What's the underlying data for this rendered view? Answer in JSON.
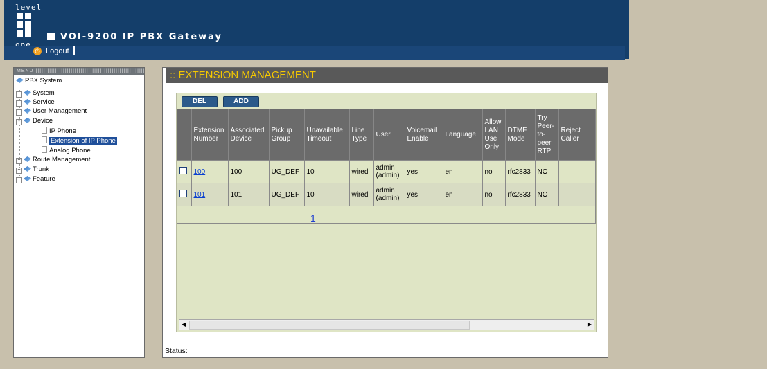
{
  "brand": {
    "logo_top": "level",
    "logo_bottom": "one"
  },
  "header": {
    "product_title": "VOI-9200 IP PBX Gateway",
    "logout_label": "Logout"
  },
  "menu": {
    "heading": "MENU",
    "root": "PBX System",
    "items": [
      {
        "label": "System",
        "expand": "+"
      },
      {
        "label": "Service",
        "expand": "+"
      },
      {
        "label": "User Management",
        "expand": "+"
      },
      {
        "label": "Device",
        "expand": "-"
      },
      {
        "label": "IP Phone"
      },
      {
        "label": "Extension of IP Phone",
        "selected": true
      },
      {
        "label": "Analog Phone"
      },
      {
        "label": "Route Management",
        "expand": "+"
      },
      {
        "label": "Trunk",
        "expand": "+"
      },
      {
        "label": "Feature",
        "expand": "+"
      }
    ]
  },
  "page": {
    "title": ":: EXTENSION MANAGEMENT",
    "del_label": "DEL",
    "add_label": "ADD",
    "columns": [
      "Extension Number",
      "Associated Device",
      "Pickup Group",
      "Unavailable Timeout",
      "Line Type",
      "User",
      "Voicemail Enable",
      "Language",
      "Allow LAN Use Only",
      "DTMF Mode",
      "Try Peer-to-peer RTP",
      "Reject Caller"
    ],
    "rows": [
      [
        "100",
        "100",
        "UG_DEF",
        "10",
        "wired",
        "admin (admin)",
        "yes",
        "en",
        "no",
        "rfc2833",
        "NO",
        ""
      ],
      [
        "101",
        "101",
        "UG_DEF",
        "10",
        "wired",
        "admin (admin)",
        "yes",
        "en",
        "no",
        "rfc2833",
        "NO",
        ""
      ]
    ],
    "page_number": "1",
    "status_label": "Status:"
  },
  "colors": {
    "header_bg": "#143e6a",
    "title_text": "#f5c800",
    "content_bg": "#dfe5c5",
    "selected_item": "#1f4f9a"
  }
}
